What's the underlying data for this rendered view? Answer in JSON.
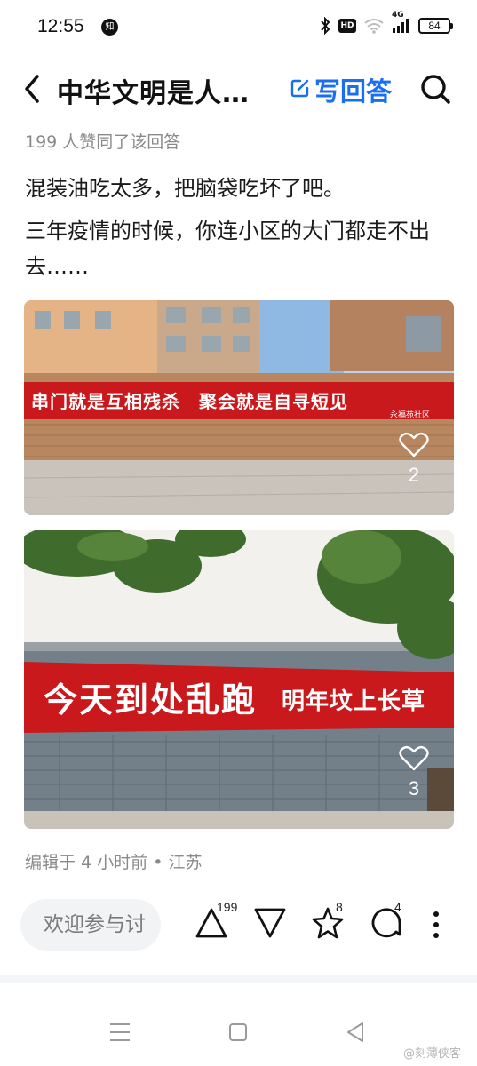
{
  "status_bar": {
    "time": "12:55",
    "app_badge": "知",
    "hd": "HD",
    "network": "4G",
    "battery": "84"
  },
  "header": {
    "title": "中华文明是人…",
    "write_answer": "写回答"
  },
  "answer": {
    "agree_text": "199 人赞同了该回答",
    "paragraphs": [
      "混装油吃太多，把脑袋吃坏了吧。",
      "三年疫情的时候，你连小区的大门都走不出去……"
    ],
    "images": [
      {
        "banner_text": "串门就是互相残杀　聚会就是自寻短见",
        "banner_small": "永福苑社区",
        "likes": "2"
      },
      {
        "banner_text": "今天到处乱跑",
        "banner_text2": "明年坟上长草",
        "likes": "3"
      }
    ],
    "edit_info": "编辑于 4 小时前 • 江苏"
  },
  "bottom_bar": {
    "comment_placeholder": "欢迎参与讨",
    "upvotes": "199",
    "favorites": "8",
    "comments": "4"
  },
  "watermark": "@刻薄侠客"
}
